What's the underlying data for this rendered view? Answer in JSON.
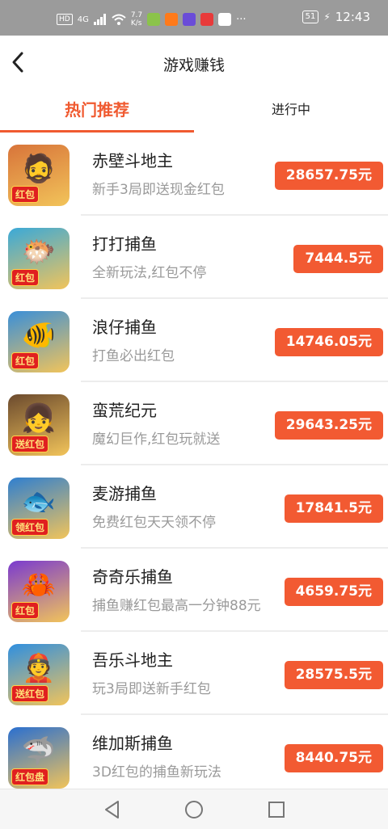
{
  "status_bar": {
    "left_chip": "HD",
    "signal": "4G",
    "speed": "7.7\nK/s",
    "battery": "51",
    "time": "12:43",
    "more": "···"
  },
  "header": {
    "title": "游戏赚钱",
    "back_icon": "chevron-left-icon"
  },
  "tabs": [
    {
      "label": "热门推荐",
      "selected": true
    },
    {
      "label": "进行中",
      "selected": false
    }
  ],
  "games": [
    {
      "name": "赤壁斗地主",
      "desc": "新手3局即送现金红包",
      "reward": "28657.75元",
      "icon_bg": "#d8743a",
      "glyph": "🧔",
      "tag": "红包"
    },
    {
      "name": "打打捕鱼",
      "desc": "全新玩法,红包不停",
      "reward": "7444.5元",
      "icon_bg": "#3aa9d8",
      "glyph": "🐡",
      "tag": "红包"
    },
    {
      "name": "浪仔捕鱼",
      "desc": "打鱼必出红包",
      "reward": "14746.05元",
      "icon_bg": "#3a8fd8",
      "glyph": "🐠",
      "tag": "红包"
    },
    {
      "name": "蛮荒纪元",
      "desc": "魔幻巨作,红包玩就送",
      "reward": "29643.25元",
      "icon_bg": "#6b4a2e",
      "glyph": "👧",
      "tag": "送红包"
    },
    {
      "name": "麦游捕鱼",
      "desc": "免费红包天天领不停",
      "reward": "17841.5元",
      "icon_bg": "#2f7fd0",
      "glyph": "🐟",
      "tag": "领红包"
    },
    {
      "name": "奇奇乐捕鱼",
      "desc": "捕鱼赚红包最高一分钟88元",
      "reward": "4659.75元",
      "icon_bg": "#7a3ad0",
      "glyph": "🦀",
      "tag": "红包"
    },
    {
      "name": "吾乐斗地主",
      "desc": "玩3局即送新手红包",
      "reward": "28575.5元",
      "icon_bg": "#2f8fe0",
      "glyph": "👲",
      "tag": "送红包"
    },
    {
      "name": "维加斯捕鱼",
      "desc": "3D红包的捕鱼新玩法",
      "reward": "8440.75元",
      "icon_bg": "#2a6fd0",
      "glyph": "🦈",
      "tag": "红包盘"
    }
  ],
  "colors": {
    "accent": "#f05a30",
    "reward_button": "#f25a32",
    "status_bar": "#9b9b9b"
  },
  "nav": {
    "back": "triangle-back-icon",
    "home": "circle-home-icon",
    "recent": "square-recent-icon"
  }
}
